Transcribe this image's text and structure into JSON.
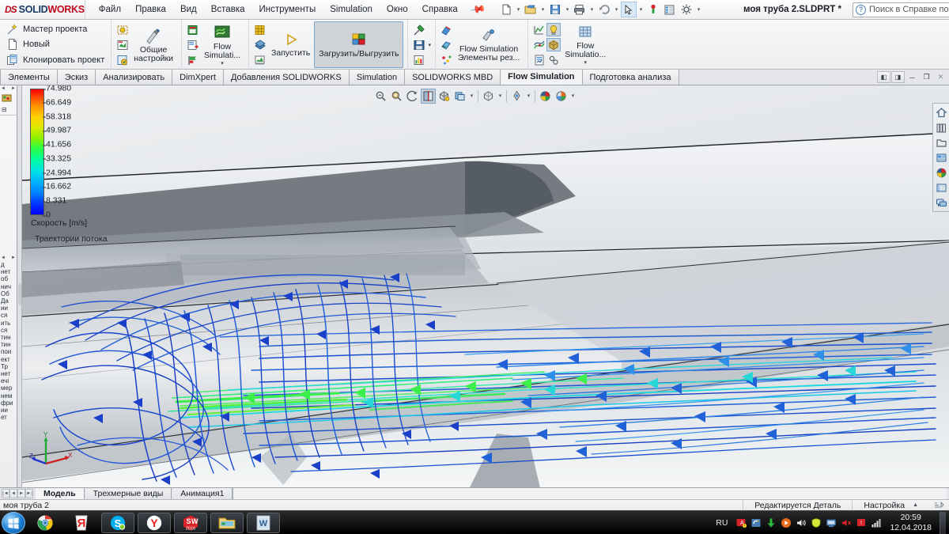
{
  "titlebar": {
    "logo_ds": "DS",
    "logo_solid": "SOLID",
    "logo_works": "WORKS",
    "menus": [
      "Файл",
      "Правка",
      "Вид",
      "Вставка",
      "Инструменты",
      "Simulation",
      "Окно",
      "Справка"
    ],
    "pin_icon": "pushpin-icon",
    "document_title": "моя труба 2.SLDPRT *",
    "search_placeholder": "Поиск в Справке по SOLIDWORKS",
    "search_value": "",
    "quick_tools": [
      "new-document-icon",
      "open-document-icon",
      "save-icon",
      "print-icon",
      "undo-icon",
      "select-icon",
      "rebuild-icon",
      "options-grid-icon",
      "settings-gear-icon"
    ],
    "help_label": "?",
    "window_buttons": [
      "minimize-icon",
      "restore-icon",
      "close-icon"
    ]
  },
  "ribbon": {
    "group_project": {
      "items": [
        {
          "label": "Мастер проекта",
          "icon": "wizard-wand-icon"
        },
        {
          "label": "Новый",
          "icon": "new-page-icon"
        },
        {
          "label": "Клонировать проект",
          "icon": "clone-project-icon"
        }
      ]
    },
    "group_settings": {
      "stack_icons": [
        "computational-domain-icon",
        "fluid-subdomain-icon",
        "component-control-icon"
      ],
      "big_label": "Общие\nнастройки",
      "big_label_line1": "Общие",
      "big_label_line2": "настройки",
      "big_icon": "general-settings-icon"
    },
    "group_flowsim": {
      "stack_icons": [
        "boundary-condition-icon",
        "goals-icon",
        "flags-icon"
      ],
      "big_label_line1": "Flow",
      "big_label_line2": "Simulati...",
      "big_icon": "flow-sim-icon",
      "has_dropdown": true
    },
    "group_run": {
      "stack_icons": [
        "mesh-icon",
        "solve-icon",
        "monitor-icon"
      ],
      "run_label": "Запустить",
      "run_icon": "play-triangle-icon",
      "loadunload_label": "Загрузить/Выгрузить",
      "loadunload_icon": "load-unload-icon",
      "loadunload_active": true
    },
    "group_results": {
      "stack_icons": [
        "probe-icon",
        "save-results-icon",
        "chart-icon"
      ]
    },
    "group_resfeatures": {
      "stack_icons": [
        "cut-plot-icon",
        "surface-plot-icon",
        "particle-study-icon"
      ],
      "big_label_line1": "Flow Simulation",
      "big_label_line2": "Элементы рез...",
      "big_icon": "result-features-icon"
    },
    "group_display": {
      "stack_icons": [
        "xy-plot-icon",
        "flow-trajectory-icon",
        "report-icon"
      ],
      "toggle_icons": [
        "lightbulb-icon",
        "display-model-icon",
        "tools-icon"
      ],
      "big_label_line1": "Flow",
      "big_label_line2": "Simulatio...",
      "big_icon": "flow-display-grid-icon",
      "has_dropdown": true
    }
  },
  "tabs": {
    "items": [
      {
        "label": "Элементы",
        "selected": false
      },
      {
        "label": "Эскиз",
        "selected": false
      },
      {
        "label": "Анализировать",
        "selected": false
      },
      {
        "label": "DimXpert",
        "selected": false
      },
      {
        "label": "Добавления SOLIDWORKS",
        "selected": false
      },
      {
        "label": "Simulation",
        "selected": false
      },
      {
        "label": "SOLIDWORKS MBD",
        "selected": false
      },
      {
        "label": "Flow Simulation",
        "selected": true
      },
      {
        "label": "Подготовка анализа",
        "selected": false
      }
    ]
  },
  "feature_manager": {
    "fragments": [
      "д",
      "нет",
      "об",
      "нич",
      "Об",
      "Да",
      "ии",
      "ся",
      "ить",
      "ся",
      "тин",
      "тин",
      "пои",
      "ект",
      "Тр",
      "нет",
      "ечі",
      "мер",
      "нем",
      "фри",
      "ии",
      "ет"
    ]
  },
  "viewport": {
    "view_toolbar": [
      {
        "icon": "zoom-to-fit-icon",
        "active": false
      },
      {
        "icon": "zoom-to-area-icon",
        "active": false
      },
      {
        "icon": "previous-view-icon",
        "active": false
      },
      {
        "icon": "section-view-icon",
        "active": true
      },
      {
        "icon": "view-orientation-icon",
        "active": false
      },
      {
        "icon": "display-style-icon",
        "active": false
      },
      {
        "icon": "hide-show-items-icon",
        "active": false
      },
      {
        "icon": "edit-appearance-icon",
        "active": false
      },
      {
        "icon": "apply-scene-icon",
        "active": false
      },
      {
        "icon": "view-settings-icon",
        "active": false
      }
    ],
    "doc_window_buttons": [
      "prev-doc-icon",
      "next-doc-icon",
      "minimize-icon",
      "restore-icon",
      "close-icon"
    ]
  },
  "task_pane": {
    "items": [
      {
        "icon": "home-resources-icon"
      },
      {
        "icon": "design-library-icon"
      },
      {
        "icon": "file-explorer-icon"
      },
      {
        "icon": "view-palette-icon"
      },
      {
        "icon": "appearances-scenes-icon"
      },
      {
        "icon": "custom-properties-icon"
      },
      {
        "icon": "solidworks-forum-icon"
      }
    ]
  },
  "chart_data": {
    "type": "heatmap",
    "title": "Скорость [m/s]",
    "subtitle": "Траектории потока",
    "colorbar_label": "Скорость [m/s]",
    "unit": "m/s",
    "ticks": [
      "74.980",
      "66.649",
      "58.318",
      "49.987",
      "41.656",
      "33.325",
      "24.994",
      "16.662",
      "8.331",
      "0"
    ],
    "values": [
      74.98,
      66.649,
      58.318,
      49.987,
      41.656,
      33.325,
      24.994,
      16.662,
      8.331,
      0
    ],
    "range": [
      0,
      74.98
    ],
    "colormap": [
      "#0000ff",
      "#0080ff",
      "#00e5e5",
      "#2bff44",
      "#e0e800",
      "#ff9000",
      "#ff0000"
    ],
    "legend_position": "top-left"
  },
  "triad": {
    "x_label": "X",
    "y_label": "Y",
    "z_label": "Z",
    "x_color": "#cc2222",
    "y_color": "#22aa33",
    "z_color": "#2233cc"
  },
  "doc_tabs": {
    "nav": [
      "first-icon",
      "prev-icon",
      "next-icon",
      "last-icon"
    ],
    "items": [
      {
        "label": "Модель",
        "selected": true
      },
      {
        "label": "Трехмерные виды",
        "selected": false
      },
      {
        "label": "Анимация1",
        "selected": false
      }
    ]
  },
  "statusbar": {
    "left_text": "моя труба 2",
    "edit_state": "Редактируется Деталь",
    "config_label": "Настройка",
    "config_caret": "▲",
    "end_icon": "resize-grip-icon"
  },
  "taskbar": {
    "start_icon": "windows-start-icon",
    "apps": [
      {
        "icon": "chrome-icon",
        "running": false
      },
      {
        "icon": "yandex-icon",
        "running": false
      },
      {
        "icon": "skype-icon",
        "running": true
      },
      {
        "icon": "yandex-browser-icon",
        "running": true
      },
      {
        "icon": "solidworks-2016-icon",
        "running": true,
        "badge": "2016"
      },
      {
        "icon": "file-explorer-icon",
        "running": true
      },
      {
        "icon": "wordpad-icon",
        "running": true
      }
    ],
    "tray": {
      "language": "RU",
      "icons": [
        "antivirus-icon",
        "update-icon",
        "download-arrow-icon",
        "media-player-icon",
        "volume-icon",
        "shield-icon",
        "network-share-icon",
        "mute-speaker-icon",
        "alert-icon",
        "signal-bars-icon"
      ],
      "time": "20:59",
      "date": "12.04.2018"
    }
  }
}
